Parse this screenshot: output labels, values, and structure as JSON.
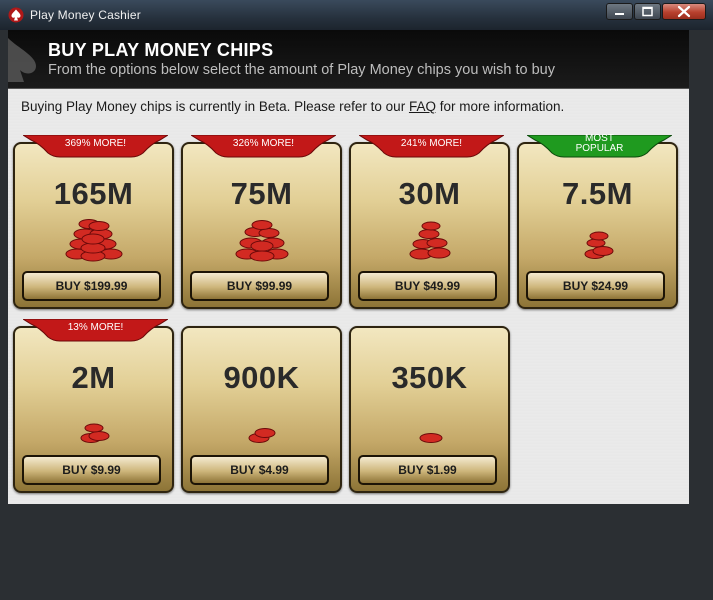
{
  "window": {
    "title": "Play Money Cashier"
  },
  "header": {
    "title": "BUY PLAY MONEY CHIPS",
    "subtitle": "From the options below select the amount of Play Money chips you wish to buy"
  },
  "notice": {
    "before": "Buying Play Money chips is currently in Beta. Please refer to our ",
    "link": "FAQ",
    "after": " for more information."
  },
  "packages": [
    {
      "amount": "165M",
      "badge": "369% MORE!",
      "badge_color": "#c21818",
      "buy_label": "BUY $199.99"
    },
    {
      "amount": "75M",
      "badge": "326% MORE!",
      "badge_color": "#c21818",
      "buy_label": "BUY $99.99"
    },
    {
      "amount": "30M",
      "badge": "241% MORE!",
      "badge_color": "#c21818",
      "buy_label": "BUY $49.99"
    },
    {
      "amount": "7.5M",
      "badge": "MOST POPULAR",
      "badge_line1": "MOST",
      "badge_line2": "POPULAR",
      "badge_color": "#1f9a1f",
      "buy_label": "BUY $24.99"
    },
    {
      "amount": "2M",
      "badge": "13% MORE!",
      "badge_color": "#c21818",
      "buy_label": "BUY $9.99"
    },
    {
      "amount": "900K",
      "badge": "",
      "buy_label": "BUY $4.99"
    },
    {
      "amount": "350K",
      "badge": "",
      "buy_label": "BUY $1.99"
    }
  ],
  "icons": {
    "app": "pokerstars-spade-icon",
    "chips": "red-poker-chips-icon",
    "minimize": "minimize-icon",
    "maximize": "maximize-icon",
    "close": "close-icon"
  },
  "colors": {
    "header_bg": "#111111",
    "chip_red": "#d22a22",
    "card_gold": "#d9c486",
    "badge_red": "#c21818",
    "badge_green": "#1f9a1f"
  }
}
